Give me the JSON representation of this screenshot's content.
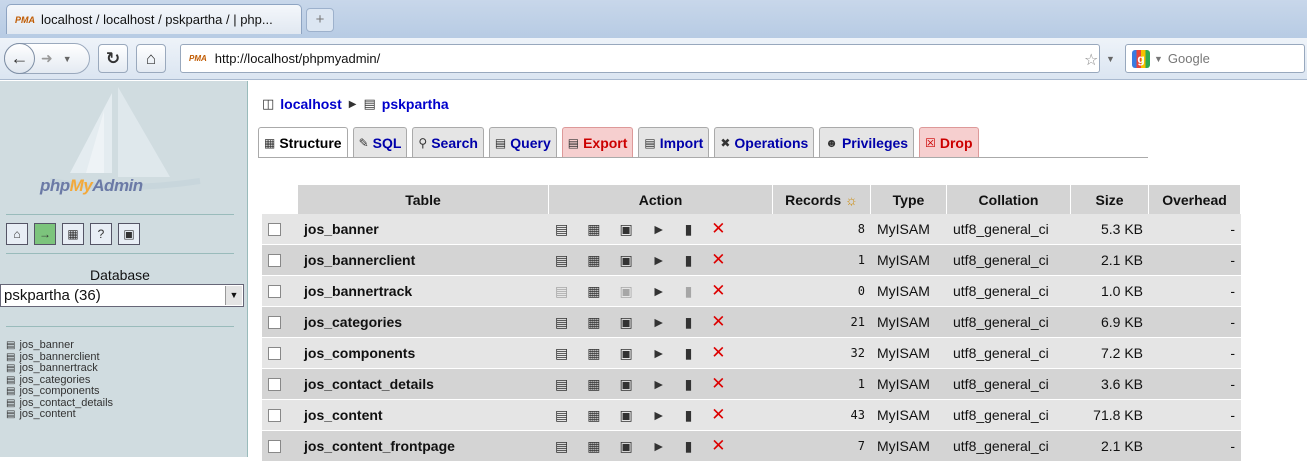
{
  "browser": {
    "tab_title": "localhost / localhost / pskpartha / | php...",
    "tab_icon_text": "PMA",
    "new_tab": "+",
    "url": "http://localhost/phpmyadmin/",
    "search_placeholder": "Google",
    "search_engine_icon": "g-icon"
  },
  "sidebar": {
    "logo": {
      "php": "php",
      "my": "My",
      "admin": "Admin"
    },
    "database_label": "Database",
    "database_selected": "pskpartha (36)",
    "tables": [
      "jos_banner",
      "jos_bannerclient",
      "jos_bannertrack",
      "jos_categories",
      "jos_components",
      "jos_contact_details",
      "jos_content"
    ]
  },
  "main": {
    "breadcrumb": {
      "server": "localhost",
      "database": "pskpartha"
    },
    "tabs": [
      {
        "label": "Structure"
      },
      {
        "label": "SQL"
      },
      {
        "label": "Search"
      },
      {
        "label": "Query"
      },
      {
        "label": "Export"
      },
      {
        "label": "Import"
      },
      {
        "label": "Operations"
      },
      {
        "label": "Privileges"
      },
      {
        "label": "Drop"
      }
    ],
    "columns": {
      "table": "Table",
      "action": "Action",
      "records": "Records",
      "type": "Type",
      "collation": "Collation",
      "size": "Size",
      "overhead": "Overhead"
    },
    "rows": [
      {
        "name": "jos_banner",
        "records": "8",
        "type": "MyISAM",
        "collation": "utf8_general_ci",
        "size": "5.3 KB",
        "overhead": "-"
      },
      {
        "name": "jos_bannerclient",
        "records": "1",
        "type": "MyISAM",
        "collation": "utf8_general_ci",
        "size": "2.1 KB",
        "overhead": "-"
      },
      {
        "name": "jos_bannertrack",
        "records": "0",
        "type": "MyISAM",
        "collation": "utf8_general_ci",
        "size": "1.0 KB",
        "overhead": "-"
      },
      {
        "name": "jos_categories",
        "records": "21",
        "type": "MyISAM",
        "collation": "utf8_general_ci",
        "size": "6.9 KB",
        "overhead": "-"
      },
      {
        "name": "jos_components",
        "records": "32",
        "type": "MyISAM",
        "collation": "utf8_general_ci",
        "size": "7.2 KB",
        "overhead": "-"
      },
      {
        "name": "jos_contact_details",
        "records": "1",
        "type": "MyISAM",
        "collation": "utf8_general_ci",
        "size": "3.6 KB",
        "overhead": "-"
      },
      {
        "name": "jos_content",
        "records": "43",
        "type": "MyISAM",
        "collation": "utf8_general_ci",
        "size": "71.8 KB",
        "overhead": "-"
      },
      {
        "name": "jos_content_frontpage",
        "records": "7",
        "type": "MyISAM",
        "collation": "utf8_general_ci",
        "size": "2.1 KB",
        "overhead": "-"
      }
    ]
  }
}
